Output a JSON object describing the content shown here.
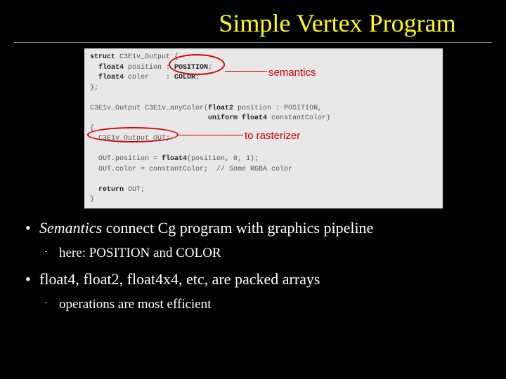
{
  "title": "Simple Vertex Program",
  "code": {
    "l1a": "struct",
    "l1b": " C3E1v_Output {",
    "l2a": "float4",
    "l2b": " position : ",
    "l2c": "POSITION",
    "l2d": ";",
    "l3a": "float4",
    "l3b": " color    : ",
    "l3c": "COLOR",
    "l3d": ";",
    "l4": "};",
    "l5": "C3E1v_Output C3E1v_anyColor(",
    "l5b": "float2",
    "l5c": " position : POSITION,",
    "l6a": "uniform float4",
    "l6b": " constantColor)",
    "l7": "{",
    "l8": "C3E1v_Output OUT;",
    "l9a": "OUT.position = ",
    "l9b": "float4",
    "l9c": "(position, 0, 1);",
    "l10": "OUT.color = constantColor;  // Some RGBA color",
    "l11a": "return",
    "l11b": " OUT;",
    "l12": "}"
  },
  "annotations": {
    "semantics": "semantics",
    "rasterizer": "to rasterizer"
  },
  "bullets": [
    {
      "html_parts": {
        "em": "Semantics",
        "rest": " connect Cg program with graphics pipeline"
      },
      "sub": [
        "here: POSITION and COLOR"
      ]
    },
    {
      "text": "float4, float2, float4x4, etc, are packed arrays",
      "sub": [
        "operations are most efficient"
      ]
    }
  ]
}
